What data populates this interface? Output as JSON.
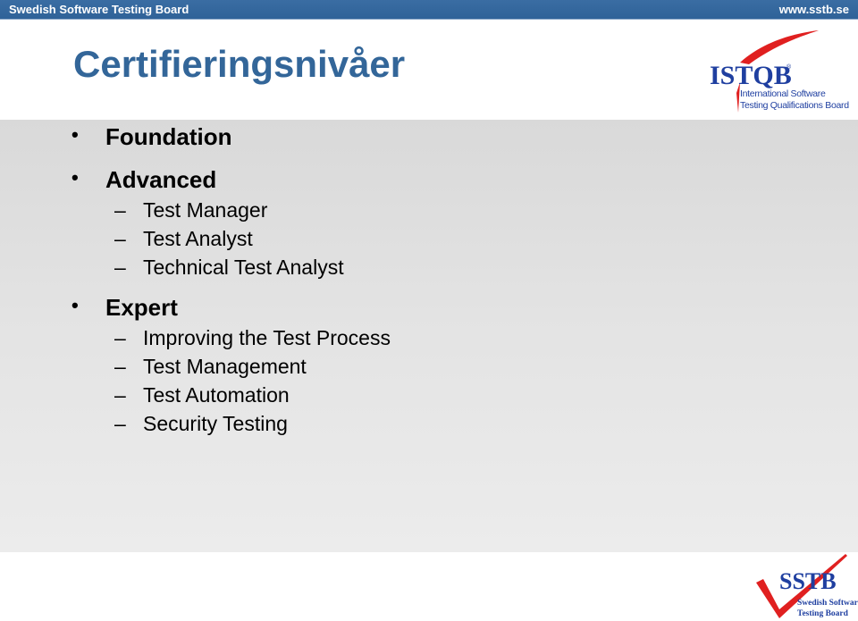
{
  "header": {
    "left_label": "Swedish Software Testing Board",
    "right_label": "www.sstb.se"
  },
  "slide": {
    "title": "Certifieringsnivåer",
    "levels": [
      {
        "label": "Foundation",
        "sub": []
      },
      {
        "label": "Advanced",
        "sub": [
          "Test Manager",
          "Test Analyst",
          "Technical Test Analyst"
        ]
      },
      {
        "label": "Expert",
        "sub": [
          "Improving the Test Process",
          "Test Management",
          "Test Automation",
          "Security Testing"
        ]
      }
    ],
    "bullet_glyph": "•",
    "dash_glyph": "–"
  },
  "logos": {
    "istqb": {
      "name": "ISTQB",
      "registered": "®",
      "line1": "International Software",
      "line2": "Testing Qualifications Board"
    },
    "sstb": {
      "name": "SSTB",
      "line1": "Swedish Software",
      "line2": "Testing Board"
    }
  },
  "colors": {
    "header_bg": "#2f6298",
    "title": "#336699",
    "logo_blue": "#1f3fa0",
    "logo_red": "#e02020"
  }
}
